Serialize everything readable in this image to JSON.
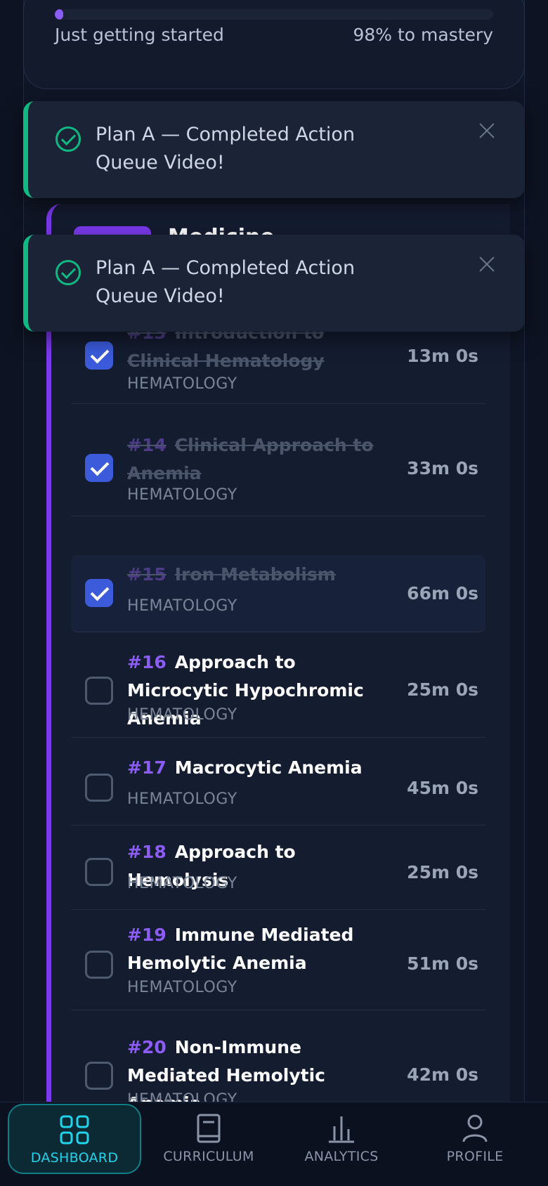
{
  "progress": {
    "percent": 1,
    "left_label": "Just getting started",
    "right_label": "98% to mastery"
  },
  "toasts": [
    {
      "message": "Plan A — Completed Action Queue Video!"
    },
    {
      "message": "Plan A — Completed Action Queue Video!"
    }
  ],
  "module": {
    "title": "Medicine"
  },
  "lessons": [
    {
      "num": "#13",
      "title": "Introduction to Clinical Hematology",
      "category": "HEMATOLOGY",
      "duration": "13m 0s",
      "done": true
    },
    {
      "num": "#14",
      "title": "Clinical Approach to Anemia",
      "category": "HEMATOLOGY",
      "duration": "33m 0s",
      "done": true
    },
    {
      "num": "#15",
      "title": "Iron Metabolism",
      "category": "HEMATOLOGY",
      "duration": "66m 0s",
      "done": true
    },
    {
      "num": "#16",
      "title": "Approach to Microcytic Hypochromic Anemia",
      "category": "HEMATOLOGY",
      "duration": "25m 0s",
      "done": false
    },
    {
      "num": "#17",
      "title": "Macrocytic Anemia",
      "category": "HEMATOLOGY",
      "duration": "45m 0s",
      "done": false
    },
    {
      "num": "#18",
      "title": "Approach to Hemolysis",
      "category": "HEMATOLOGY",
      "duration": "25m 0s",
      "done": false
    },
    {
      "num": "#19",
      "title": "Immune Mediated Hemolytic Anemia",
      "category": "HEMATOLOGY",
      "duration": "51m 0s",
      "done": false
    },
    {
      "num": "#20",
      "title": "Non-Immune Mediated Hemolytic Anemia",
      "category": "HEMATOLOGY",
      "duration": "42m 0s",
      "done": false
    }
  ],
  "nav": {
    "dashboard": "DASHBOARD",
    "curriculum": "CURRICULUM",
    "analytics": "ANALYTICS",
    "profile": "PROFILE"
  },
  "colors": {
    "accent": "#8b5cf6",
    "success": "#10b981",
    "nav_active": "#22d3ee"
  }
}
